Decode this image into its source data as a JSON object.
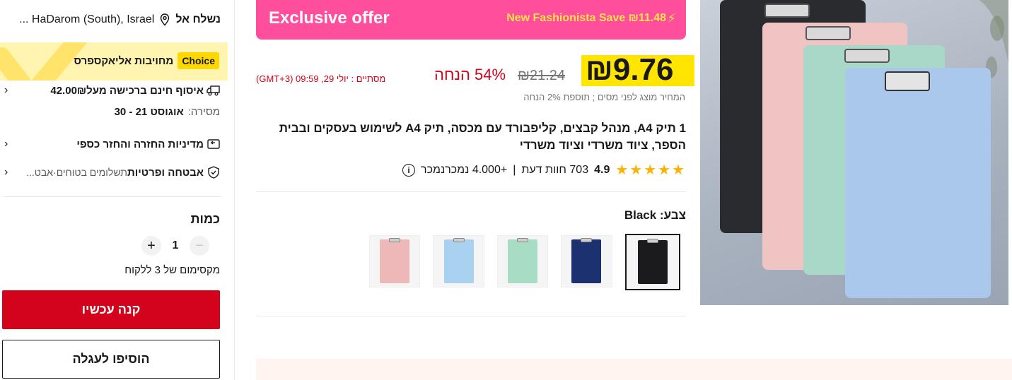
{
  "shipping": {
    "label": "נשלח אל",
    "location": "HaDarom (South), Israel ..."
  },
  "choice": {
    "badge": "Choice",
    "text": "מחויבות אליאקספרס"
  },
  "delivery": {
    "free_shipping": "איסוף חינם ברכישה מעל",
    "free_shipping_amount": "42.00₪",
    "delivery_label": "מסירה:",
    "delivery_dates": "אוגוסט 21 - 30"
  },
  "policies": {
    "return": "מדיניות החזרה והחזר כספי",
    "security_title": "אבטחה ופרטיות",
    "security_sub": "תשלומים בטוחים·אבט..."
  },
  "quantity": {
    "title": "כמות",
    "value": "1",
    "minus": "−",
    "plus": "+",
    "max_note": "מקסימום של 3 ללקוח"
  },
  "buttons": {
    "buy_now": "קנה עכשיו",
    "add_to_cart": "הוסיפו לעגלה"
  },
  "offer": {
    "title": "Exclusive offer",
    "promo": "New Fashionista Save ₪11.48"
  },
  "price": {
    "current": "₪9.76",
    "original": "₪21.24",
    "discount": "54% הנחה",
    "ends": "מסתיים :  יולי 29, 09:59 (GMT+3)",
    "tax_note": "המחיר מוצג לפני מסים ; תוספת 2% הנחה"
  },
  "product": {
    "title": "1 תיק A4, מנהל קבצים, קליפבורד עם מכסה, תיק A4 לשימוש בעסקים ובבית הספר, ציוד משרדי וציוד משרדי",
    "rating": "4.9",
    "stars": "★★★★★",
    "reviews": "703 חוות דעת",
    "sold": "+4.000  נמכרנמכר"
  },
  "color": {
    "label": "צבע:",
    "selected": "Black",
    "options": [
      {
        "name": "Black",
        "hex": "#1b1b1d"
      },
      {
        "name": "Navy",
        "hex": "#1c3170"
      },
      {
        "name": "Mint",
        "hex": "#a8dcc4"
      },
      {
        "name": "Sky Blue",
        "hex": "#a9d2f0"
      },
      {
        "name": "Pink",
        "hex": "#efb8b8"
      }
    ]
  },
  "colors": {
    "brand_red": "#d3031c",
    "offer_pink": "#fe4e9c",
    "price_yellow": "#ffe500",
    "star": "#fdb102"
  }
}
